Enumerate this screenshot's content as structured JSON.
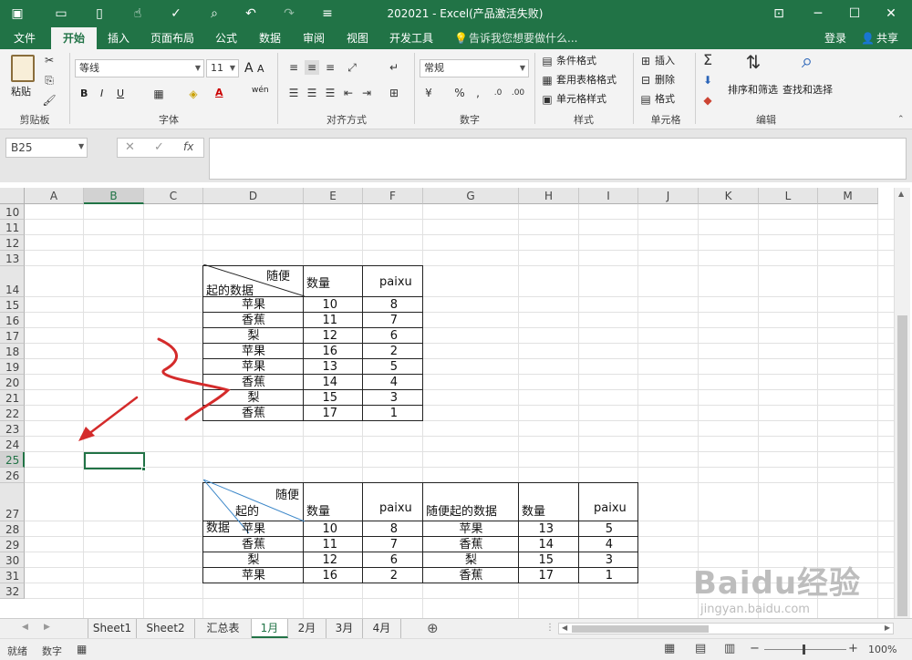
{
  "titlebar": {
    "title": "202021 - Excel(产品激活失败)"
  },
  "tabs": [
    "文件",
    "开始",
    "插入",
    "页面布局",
    "公式",
    "数据",
    "审阅",
    "视图",
    "开发工具"
  ],
  "tellme": "告诉我您想要做什么...",
  "login": "登录",
  "share": "共享",
  "ribbon": {
    "paste": "剪贴板",
    "paste_btn": "粘贴",
    "font_name": "等线",
    "font_size": "11",
    "font_group": "字体",
    "align_group": "对齐方式",
    "number_format": "常规",
    "number_group": "数字",
    "cond_format": "条件格式",
    "table_format": "套用表格格式",
    "cell_style": "单元格样式",
    "style_group": "样式",
    "insert": "插入",
    "delete": "删除",
    "format": "格式",
    "cells_group": "单元格",
    "sort_filter": "排序和筛选",
    "find_select": "查找和选择",
    "edit_group": "编辑",
    "bold": "B",
    "italic": "I",
    "underline": "U",
    "font_a_big": "A",
    "font_a_small": "A",
    "wen": "wén"
  },
  "formula": {
    "namebox": "B25",
    "fx": "fx",
    "value": ""
  },
  "columns": [
    "A",
    "B",
    "C",
    "D",
    "E",
    "F",
    "G",
    "H",
    "I",
    "J",
    "K",
    "L",
    "M"
  ],
  "rows": [
    "10",
    "11",
    "12",
    "13",
    "14",
    "15",
    "16",
    "17",
    "18",
    "19",
    "20",
    "21",
    "22",
    "23",
    "24",
    "25",
    "26",
    "27",
    "28",
    "29",
    "30",
    "31",
    "32"
  ],
  "table1": {
    "header_top": "随便",
    "header_bottom": "起的数据",
    "h_count": "数量",
    "h_sort": "paixu",
    "rows": [
      [
        "苹果",
        "10",
        "8"
      ],
      [
        "香蕉",
        "11",
        "7"
      ],
      [
        "梨",
        "12",
        "6"
      ],
      [
        "苹果",
        "16",
        "2"
      ],
      [
        "苹果",
        "13",
        "5"
      ],
      [
        "香蕉",
        "14",
        "4"
      ],
      [
        "梨",
        "15",
        "3"
      ],
      [
        "香蕉",
        "17",
        "1"
      ]
    ]
  },
  "table2": {
    "header_top": "随便",
    "header_mid": "起的",
    "header_bottom": "数据",
    "h_count": "数量",
    "h_sort": "paixu",
    "h_data2": "随便起的数据",
    "h_count2": "数量",
    "h_sort2": "paixu",
    "rows": [
      [
        "苹果",
        "10",
        "8",
        "苹果",
        "13",
        "5"
      ],
      [
        "香蕉",
        "11",
        "7",
        "香蕉",
        "14",
        "4"
      ],
      [
        "梨",
        "12",
        "6",
        "梨",
        "15",
        "3"
      ],
      [
        "苹果",
        "16",
        "2",
        "香蕉",
        "17",
        "1"
      ]
    ]
  },
  "sheets": [
    "Sheet1",
    "Sheet2",
    "汇总表",
    "1月",
    "2月",
    "3月",
    "4月"
  ],
  "active_sheet": "1月",
  "status": {
    "ready": "就绪",
    "mode": "数字",
    "zoom": "100%"
  },
  "watermark": {
    "brand": "Baidu经验",
    "url": "jingyan.baidu.com"
  },
  "colors": {
    "excel_green": "#217346",
    "annotation_red": "#d42b2b"
  }
}
